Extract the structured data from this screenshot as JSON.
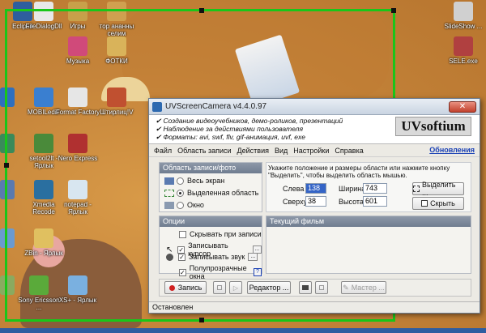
{
  "desktop": {
    "icons": [
      {
        "label": "Eclipse",
        "color": "#2e5e9e"
      },
      {
        "label": "FileDialogDll",
        "color": "#e8e8e8"
      },
      {
        "label": "Игры",
        "color": "#c8a04a"
      },
      {
        "label": "тор ананны селим",
        "color": "#d0a050"
      },
      {
        "label": "Музыка",
        "color": "#d04a7a"
      },
      {
        "label": "ФОТКИ",
        "color": "#d9b35a"
      },
      {
        "label": "MOBILedit!",
        "color": "#3a7fd0"
      },
      {
        "label": "Format Factory",
        "color": "#e6e6e6"
      },
      {
        "label": "Штирлиц!V",
        "color": "#c05030"
      },
      {
        "label": "setool2lt - Ярлык",
        "color": "#4a8a3a"
      },
      {
        "label": "Nero Express",
        "color": "#b03030"
      },
      {
        "label": "Xmedia Recode",
        "color": "#2a6fa0"
      },
      {
        "label": "notepad - Ярлык",
        "color": "#d8e6f0"
      },
      {
        "label": "ZBin - Ярлык",
        "color": "#e0c060"
      },
      {
        "label": "Sony Ericsson ...",
        "color": "#5aaa3a"
      },
      {
        "label": "XS+ - Ярлык",
        "color": "#7ab0e0"
      },
      {
        "label": "SlideShow ...",
        "color": "#d0d0d0"
      },
      {
        "label": "SELE.exe",
        "color": "#b04040"
      }
    ],
    "frame_color": "#19c619"
  },
  "window": {
    "title": "UVScreenCamera v4.4.0.97",
    "close_label": "✕",
    "features": [
      "✔ Создание видеоучебников, демо-роликов, презентаций",
      "✔ Наблюдение за действиями пользователя",
      "✔ Форматы: avi, swf, flv, gif-анимация, uvf, exe"
    ],
    "logo": "UVsoftium",
    "updates_link": "Обновления",
    "menu": [
      "Файл",
      "Область записи",
      "Действия",
      "Вид",
      "Настройки",
      "Справка"
    ],
    "area_panel": {
      "title": "Область записи/фото",
      "options": [
        {
          "label": "Весь экран",
          "selected": false
        },
        {
          "label": "Выделенная область",
          "selected": true
        },
        {
          "label": "Окно",
          "selected": false
        }
      ]
    },
    "hint": "Укажите положение и размеры области или нажмите кнопку \"Выделить\", чтобы выделить область мышью.",
    "fields": {
      "left_label": "Слева",
      "left_value": "138",
      "width_label": "Ширина",
      "width_value": "743",
      "top_label": "Сверху",
      "top_value": "38",
      "height_label": "Высота",
      "height_value": "601"
    },
    "select_button": "Выделить ...",
    "hide_button": "Скрыть",
    "options_panel": {
      "title": "Опции",
      "items": [
        {
          "label": "Скрывать при записи",
          "checked": false,
          "more": false
        },
        {
          "label": "Записывать курсор",
          "checked": true,
          "more": true
        },
        {
          "label": "Записывать звук",
          "checked": true,
          "more": true
        },
        {
          "label": "Полупрозрачные окна",
          "checked": true,
          "more": false,
          "help": "?"
        }
      ]
    },
    "current_movie_panel": {
      "title": "Текущий фильм"
    },
    "toolbar": {
      "record": "Запись",
      "editor": "Редактор ...",
      "master": "Мастер ..."
    },
    "status": "Остановлен",
    "accent_color": "#6f7c8f"
  }
}
